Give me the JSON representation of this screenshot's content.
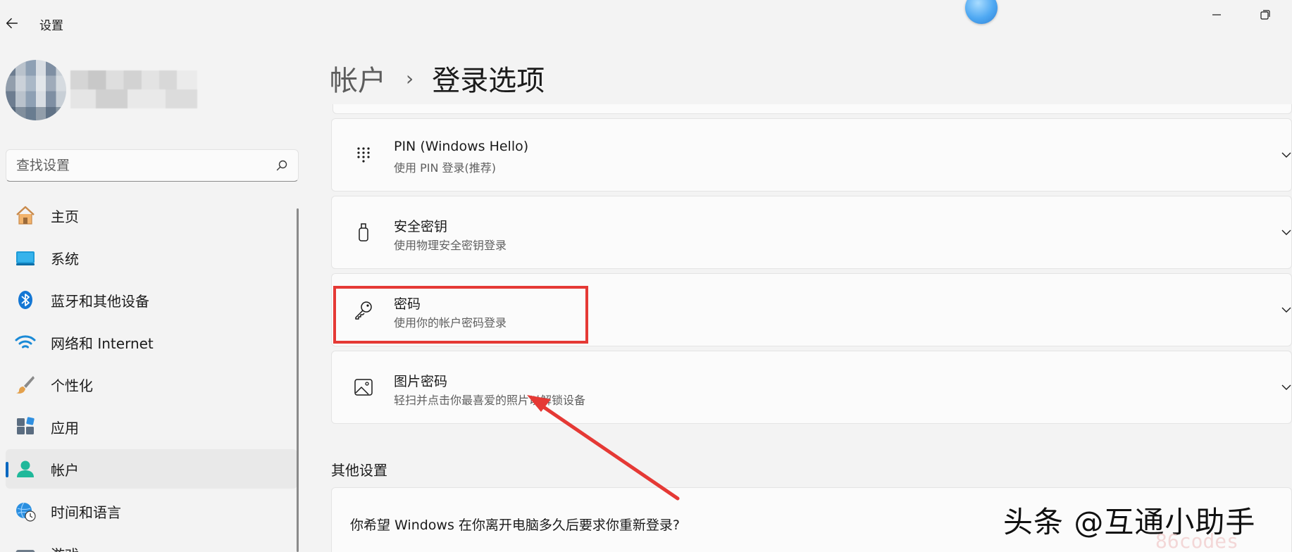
{
  "window": {
    "title": "设置"
  },
  "search": {
    "placeholder": "查找设置"
  },
  "sidebar": {
    "items": [
      {
        "label": "主页",
        "icon": "home-icon"
      },
      {
        "label": "系统",
        "icon": "system-icon"
      },
      {
        "label": "蓝牙和其他设备",
        "icon": "bluetooth-icon"
      },
      {
        "label": "网络和 Internet",
        "icon": "wifi-icon"
      },
      {
        "label": "个性化",
        "icon": "brush-icon"
      },
      {
        "label": "应用",
        "icon": "apps-icon"
      },
      {
        "label": "帐户",
        "icon": "account-icon",
        "active": true
      },
      {
        "label": "时间和语言",
        "icon": "globe-clock-icon"
      },
      {
        "label": "游戏",
        "icon": "gamepad-icon"
      }
    ]
  },
  "breadcrumb": {
    "parent": "帐户",
    "separator": "›",
    "current": "登录选项"
  },
  "signin_options": [
    {
      "title": "PIN (Windows Hello)",
      "subtitle": "使用 PIN 登录(推荐)",
      "icon": "keypad-icon"
    },
    {
      "title": "安全密钥",
      "subtitle": "使用物理安全密钥登录",
      "icon": "usb-key-icon"
    },
    {
      "title": "密码",
      "subtitle": "使用你的帐户密码登录",
      "icon": "key-icon",
      "highlighted": true
    },
    {
      "title": "图片密码",
      "subtitle": "轻扫并点击你最喜爱的照片以解锁设备",
      "icon": "picture-icon"
    }
  ],
  "other_settings": {
    "heading": "其他设置",
    "question": "你希望 Windows 在你离开电脑多久后要求你重新登录?"
  },
  "watermark": {
    "text": "头条 @互通小助手",
    "faint": "86codes"
  },
  "colors": {
    "accent": "#0067c0",
    "annotation": "#e53935",
    "background": "#f3f3f3",
    "card": "#fbfbfb"
  }
}
